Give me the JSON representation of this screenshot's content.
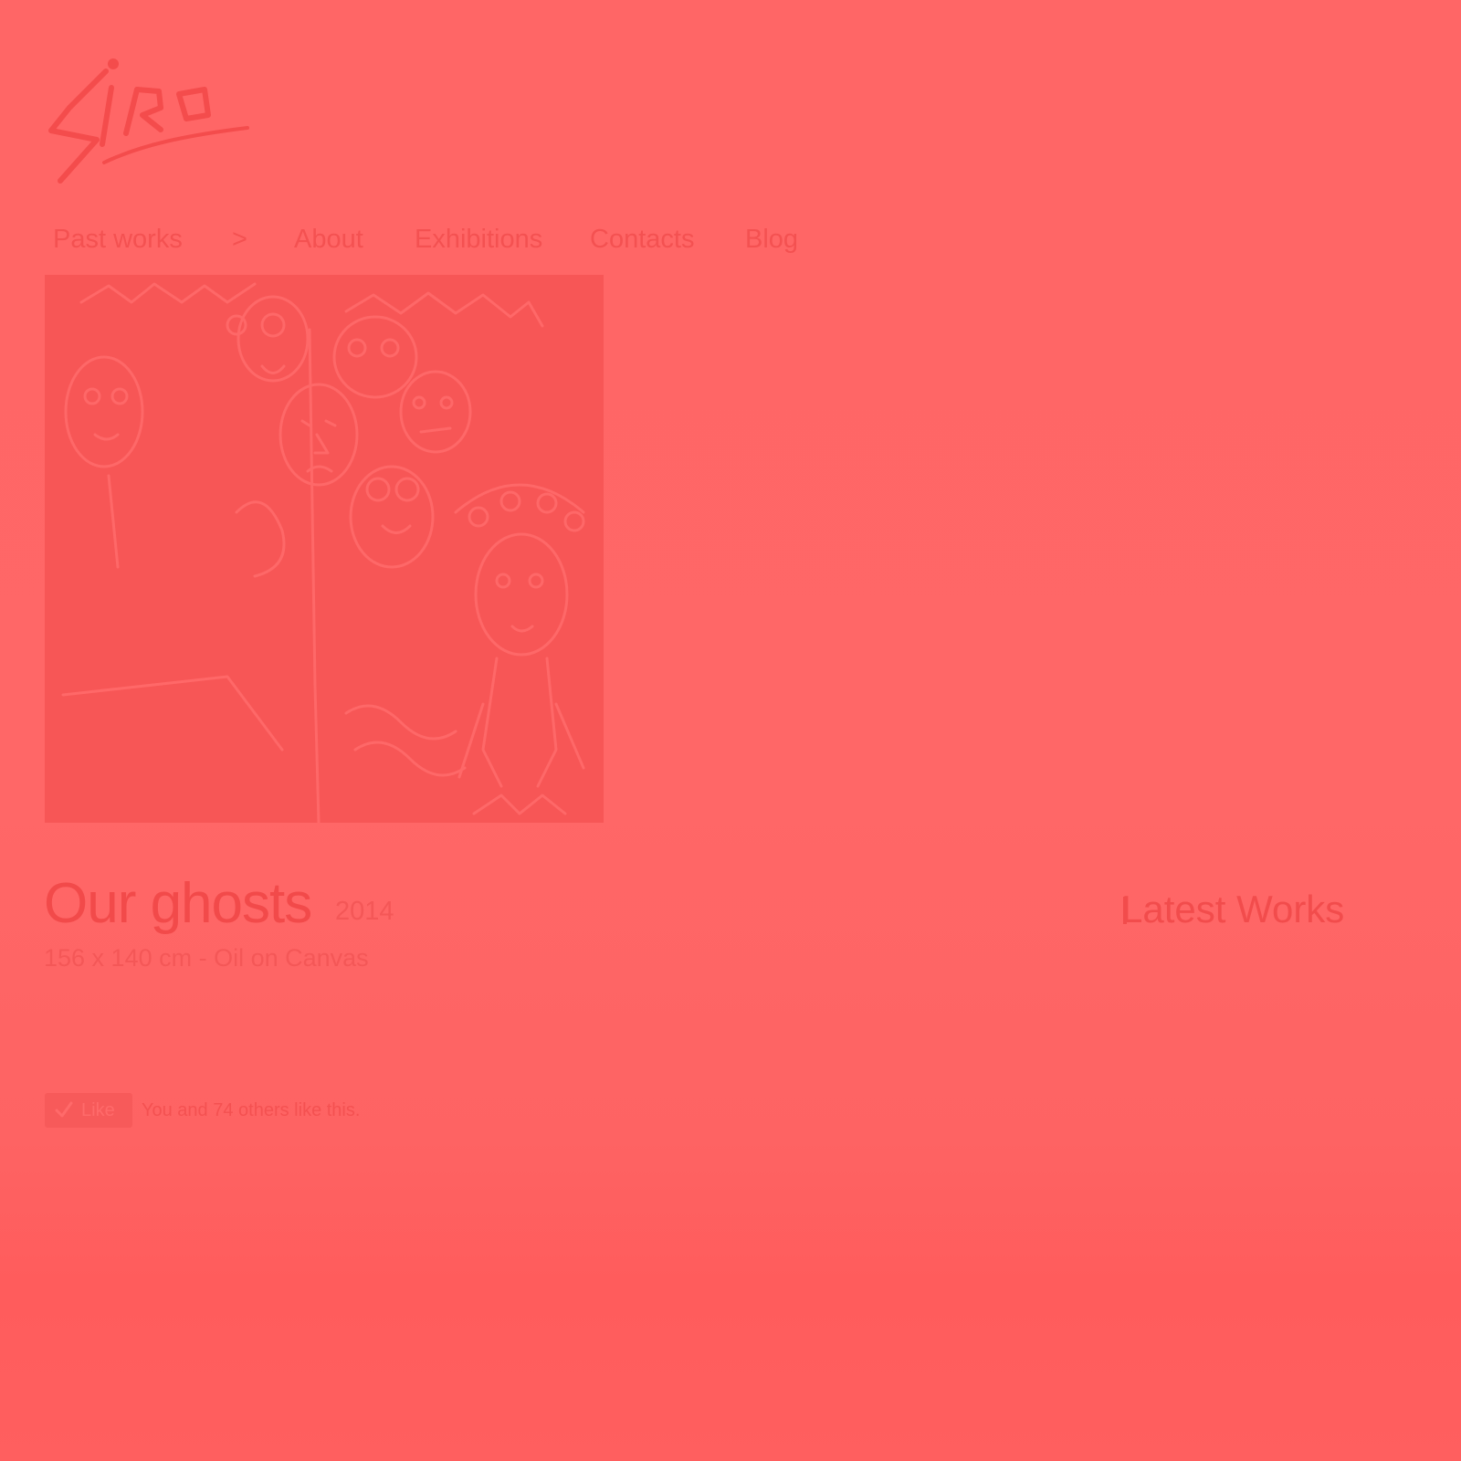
{
  "logo": {
    "text": "SIRO"
  },
  "nav": {
    "items": [
      "Past works",
      ">",
      "About",
      "Exhibitions",
      "Contacts",
      "Blog"
    ]
  },
  "artwork": {
    "title": "Our ghosts",
    "year": "2014",
    "details": "156 x 140 cm - Oil on Canvas"
  },
  "sidebar": {
    "heading": "Latest Works"
  },
  "like": {
    "button_label": "Like",
    "count_text": "You and 74 others like this."
  },
  "colors": {
    "background": "#ff6666",
    "text": "#f44b4b",
    "painting": "#f75656"
  }
}
